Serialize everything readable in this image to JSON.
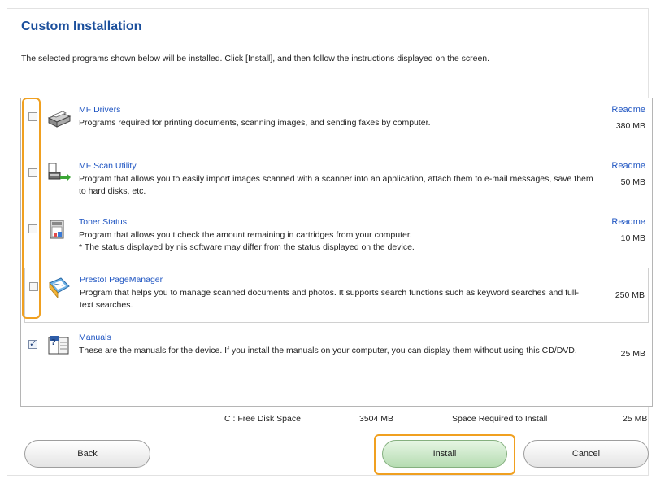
{
  "header": {
    "title": "Custom Installation",
    "instruction": "The selected programs shown below will be installed. Click [Install], and then follow the instructions displayed on the screen."
  },
  "programs": [
    {
      "name": "MF Drivers",
      "description": "Programs required for printing documents, scanning images, and sending faxes by computer.",
      "readme": "Readme",
      "size": "380 MB",
      "checked": false,
      "icon": "printer-icon"
    },
    {
      "name": "MF Scan Utility",
      "description": "Program that allows you to easily import images scanned with a scanner into an application, attach them to e-mail messages, save them to hard disks, etc.",
      "readme": "Readme",
      "size": "50 MB",
      "checked": false,
      "icon": "scanner-icon"
    },
    {
      "name": "Toner Status",
      "description": "Program that allows you t   check the amount remaining in cartridges from your computer.\n* The status displayed by   nis software may differ from the status displayed on the device.",
      "readme": "Readme",
      "size": "10 MB",
      "checked": false,
      "icon": "toner-icon"
    },
    {
      "name": "Presto! PageManager",
      "description": "Program that helps you to manage scanned documents and photos. It supports search functions such as keyword searches and full-text searches.",
      "readme": "",
      "size": "250 MB",
      "checked": false,
      "icon": "pagemanager-icon"
    },
    {
      "name": "Manuals",
      "description": "These are the manuals for the device. If you install the manuals on your computer, you can display them without using this CD/DVD.",
      "readme": "",
      "size": "25 MB",
      "checked": true,
      "icon": "manual-book-icon"
    }
  ],
  "disk": {
    "free_label": "C : Free Disk Space",
    "free_value": "3504 MB",
    "required_label": "Space Required to Install",
    "required_value": "25 MB"
  },
  "buttons": {
    "back": "Back",
    "install": "Install",
    "cancel": "Cancel"
  },
  "colors": {
    "title": "#1b4f9c",
    "link": "#1f55c2",
    "highlight": "#f0a020",
    "install_button": "#b6dcb2"
  }
}
